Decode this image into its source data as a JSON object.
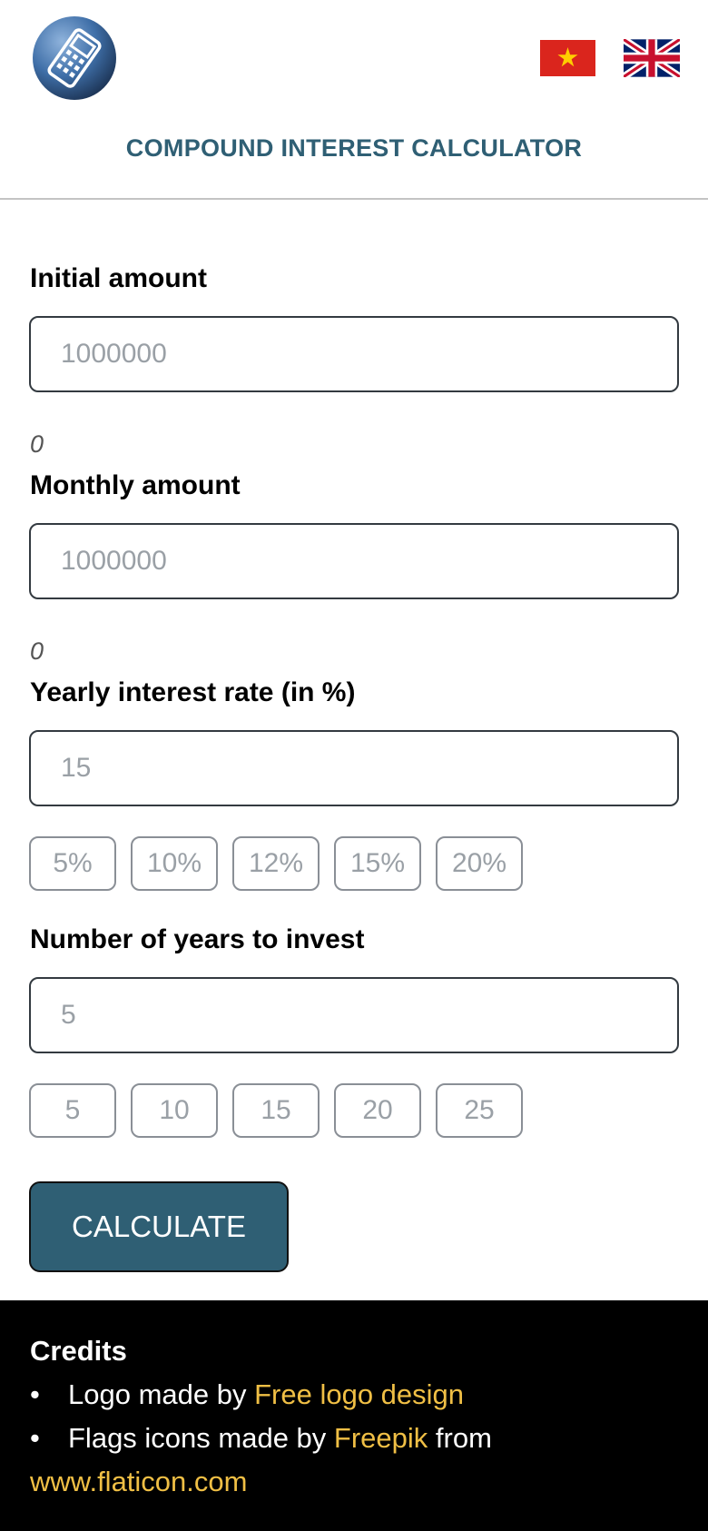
{
  "header": {
    "title": "COMPOUND INTEREST CALCULATOR"
  },
  "form": {
    "initial": {
      "label": "Initial amount",
      "placeholder": "1000000",
      "hint": "0"
    },
    "monthly": {
      "label": "Monthly amount",
      "placeholder": "1000000",
      "hint": "0"
    },
    "rate": {
      "label": "Yearly interest rate (in %)",
      "placeholder": "15",
      "presets": [
        "5%",
        "10%",
        "12%",
        "15%",
        "20%"
      ]
    },
    "years": {
      "label": "Number of years to invest",
      "placeholder": "5",
      "presets": [
        "5",
        "10",
        "15",
        "20",
        "25"
      ]
    },
    "calculate_label": "CALCULATE"
  },
  "footer": {
    "credits_title": "Credits",
    "line1_prefix": "Logo made by ",
    "line1_link": "Free logo design",
    "line2_prefix": "Flags icons made by ",
    "line2_link": "Freepik",
    "line2_suffix": " from",
    "line3_link": "www.flaticon.com"
  },
  "colors": {
    "brand": "#2f5f74",
    "link": "#f0bf45",
    "footer_bg": "#000000"
  },
  "icons": [
    "calculator-phone-logo",
    "vietnam-flag-icon",
    "uk-flag-icon"
  ]
}
